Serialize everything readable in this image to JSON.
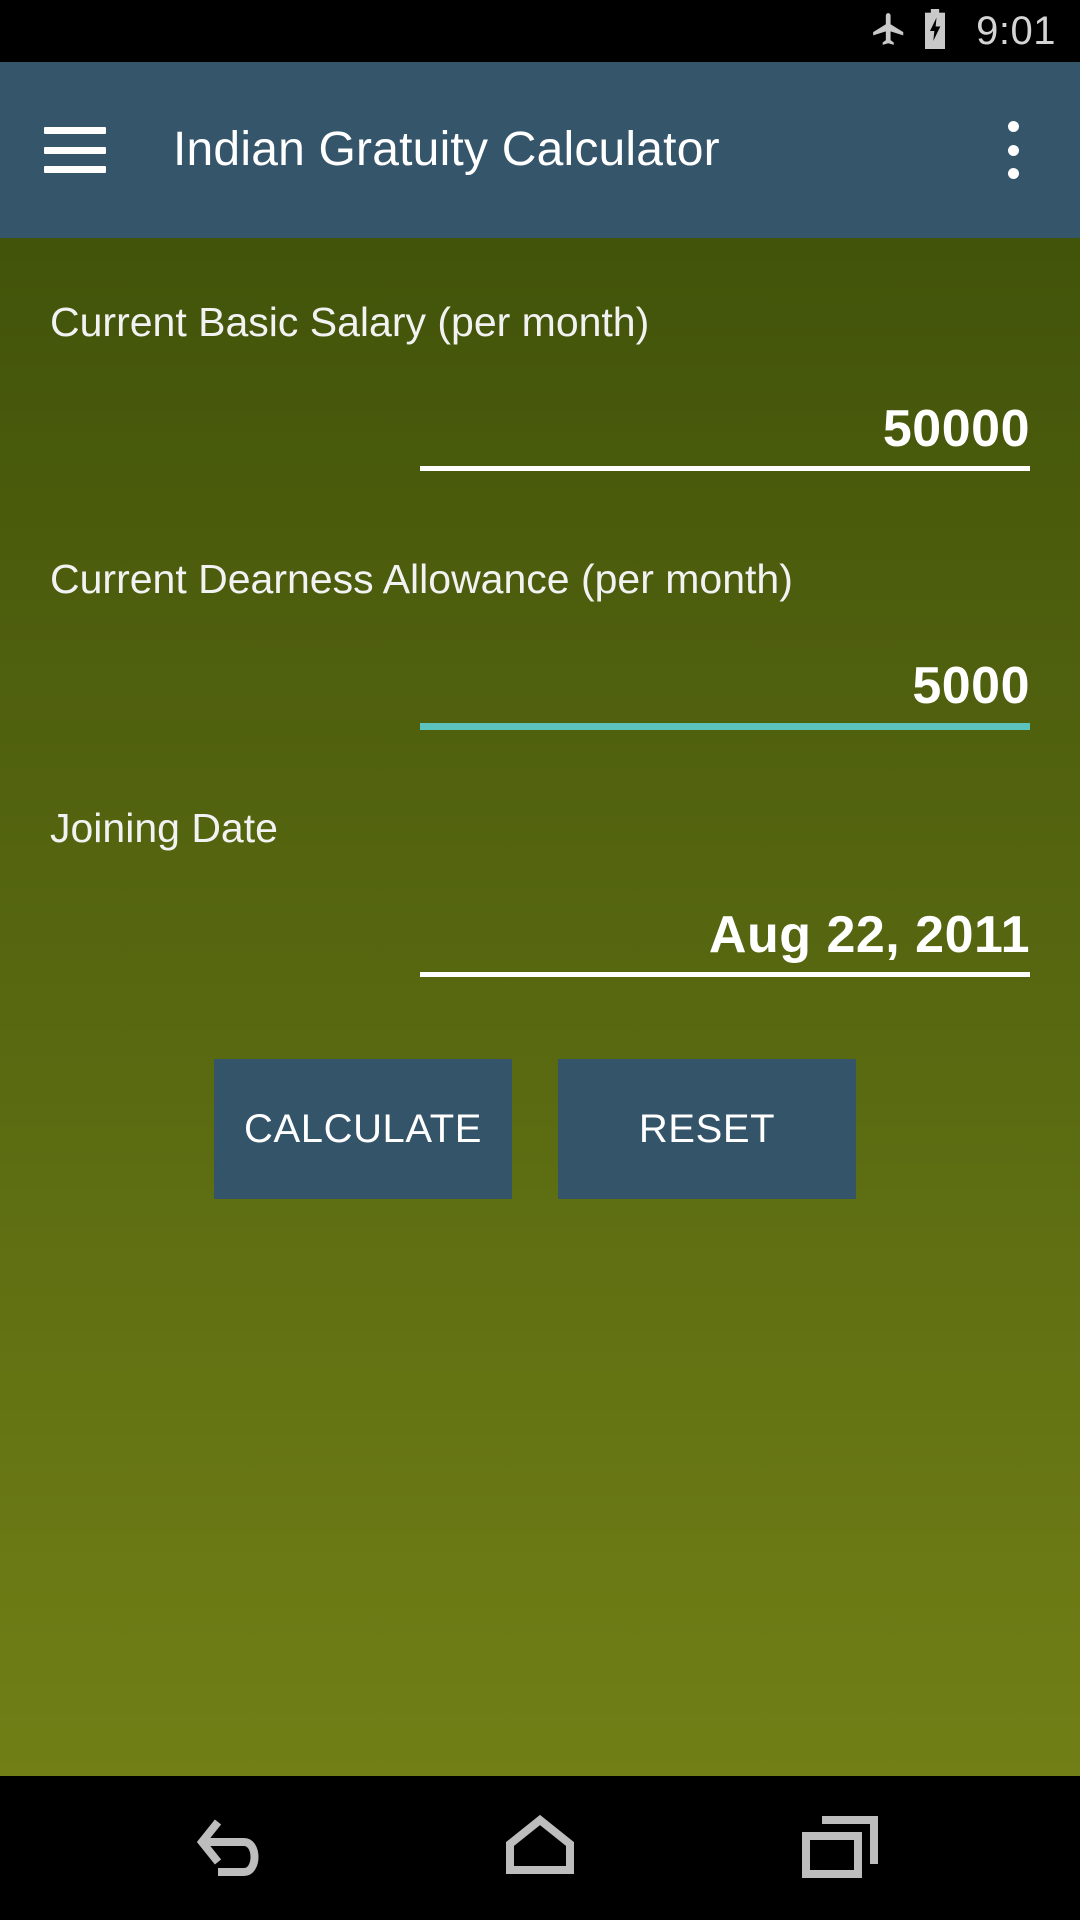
{
  "status_bar": {
    "airplane_icon": "airplane-mode-icon",
    "battery_icon": "battery-charging-icon",
    "time": "9:01"
  },
  "app_bar": {
    "menu_icon": "hamburger-menu-icon",
    "title": "Indian Gratuity Calculator",
    "overflow_icon": "overflow-menu-icon",
    "background_color": "#35556B"
  },
  "theme": {
    "background_top": "#42540A",
    "background_bottom": "#717F16",
    "accent_focused": "#5CC2BE",
    "button_color": "#34546A",
    "text_color": "#FFFFFF"
  },
  "form": {
    "fields": [
      {
        "label": "Current Basic Salary (per month)",
        "value": "50000",
        "placeholder": "",
        "focused": false,
        "underline_color": "#FFFFFF"
      },
      {
        "label": "Current Dearness Allowance (per month)",
        "value": "5000",
        "placeholder": "",
        "focused": true,
        "underline_color": "#5CC2BE"
      },
      {
        "label": "Joining Date",
        "value": "Aug 22, 2011",
        "placeholder": "",
        "focused": false,
        "underline_color": "#FFFFFF"
      }
    ]
  },
  "actions": {
    "calculate_label": "CALCULATE",
    "reset_label": "RESET"
  },
  "nav_bar": {
    "back_icon": "back-arrow-icon",
    "home_icon": "home-icon",
    "recents_icon": "recent-apps-icon"
  }
}
